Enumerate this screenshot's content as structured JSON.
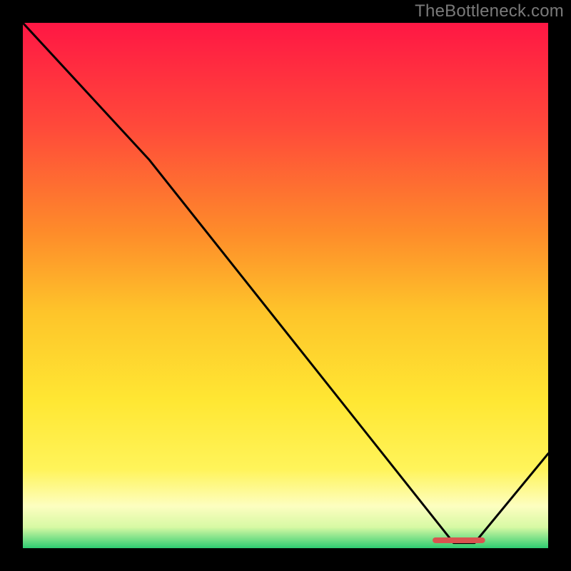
{
  "watermark": "TheBottleneck.com",
  "chart_data": {
    "type": "line",
    "title": "",
    "xlabel": "",
    "ylabel": "",
    "xlim": [
      0,
      100
    ],
    "ylim": [
      0,
      100
    ],
    "grid": false,
    "legend": false,
    "x": [
      0,
      24,
      82,
      86,
      100
    ],
    "values": [
      100,
      74,
      1,
      1,
      18
    ],
    "marker": {
      "x_start": 78,
      "x_end": 88,
      "y": 1.5,
      "color": "#d9534f"
    },
    "background_gradient": {
      "stops": [
        {
          "offset": 0,
          "color": "#ff1744"
        },
        {
          "offset": 0.2,
          "color": "#ff4a3a"
        },
        {
          "offset": 0.4,
          "color": "#fe8c2a"
        },
        {
          "offset": 0.55,
          "color": "#fec42a"
        },
        {
          "offset": 0.72,
          "color": "#ffe733"
        },
        {
          "offset": 0.85,
          "color": "#fff45a"
        },
        {
          "offset": 0.92,
          "color": "#fdfec0"
        },
        {
          "offset": 0.96,
          "color": "#d7f9a4"
        },
        {
          "offset": 1.0,
          "color": "#2ecc71"
        }
      ]
    }
  }
}
